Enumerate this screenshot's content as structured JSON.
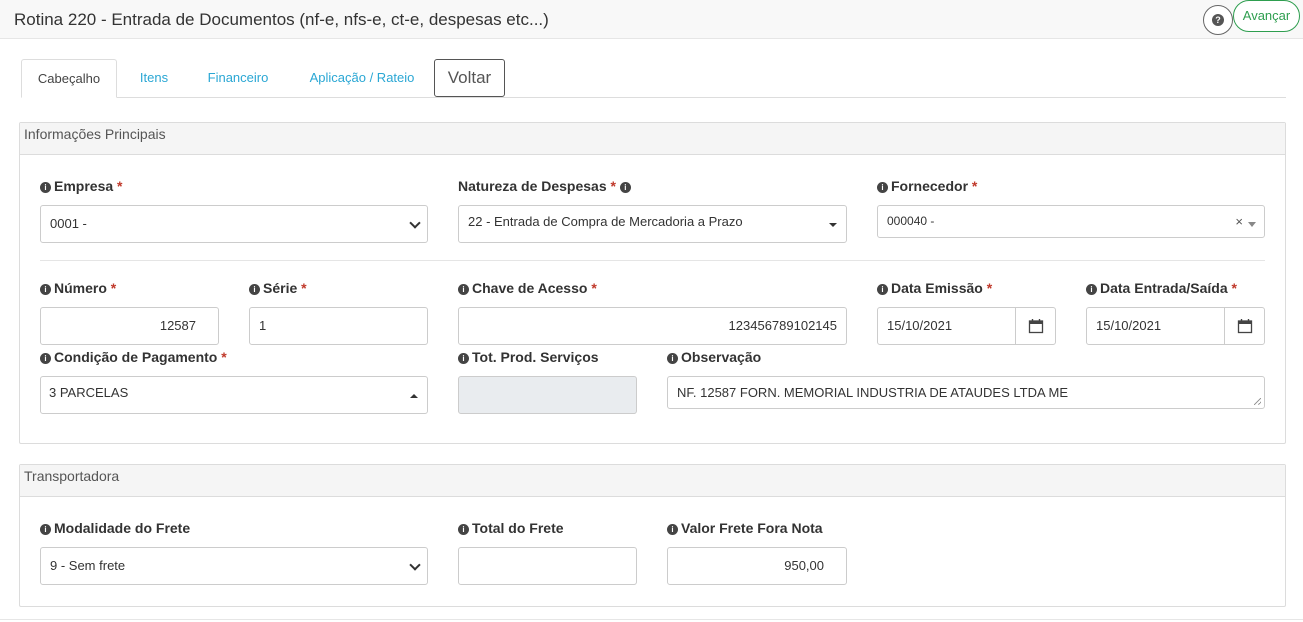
{
  "header": {
    "title": "Rotina 220 - Entrada de Documentos (nf-e, nfs-e, ct-e, despesas etc...)",
    "help_glyph": "?",
    "advance_label": "Avançar"
  },
  "tabs": [
    {
      "label": "Cabeçalho",
      "active": true
    },
    {
      "label": "Itens",
      "active": false
    },
    {
      "label": "Financeiro",
      "active": false
    },
    {
      "label": "Aplicação / Rateio",
      "active": false
    }
  ],
  "back_label": "Voltar",
  "main_info": {
    "title": "Informações Principais",
    "empresa": {
      "label": "Empresa",
      "required": "*",
      "value": "0001 -"
    },
    "natureza": {
      "label": "Natureza de Despesas",
      "required": "*",
      "value": "22 - Entrada de Compra de Mercadoria a Prazo"
    },
    "fornecedor": {
      "label": "Fornecedor",
      "required": "*",
      "value": "000040 -",
      "clear": "×"
    },
    "numero": {
      "label": "Número",
      "required": "*",
      "value": "12587"
    },
    "serie": {
      "label": "Série",
      "required": "*",
      "value": "1"
    },
    "chave": {
      "label": "Chave de Acesso",
      "required": "*",
      "value": "123456789102145"
    },
    "data_emissao": {
      "label": "Data Emissão",
      "required": "*",
      "value": "15/10/2021"
    },
    "data_entrada": {
      "label": "Data Entrada/Saída",
      "required": "*",
      "value": "15/10/2021"
    },
    "condicao": {
      "label": "Condição de Pagamento",
      "required": "*",
      "value": "3 PARCELAS"
    },
    "tot_prod": {
      "label": "Tot. Prod. Serviços",
      "value": ""
    },
    "observacao": {
      "label": "Observação",
      "value": "NF. 12587 FORN. MEMORIAL INDUSTRIA DE ATAUDES LTDA ME"
    }
  },
  "transport": {
    "title": "Transportadora",
    "modalidade": {
      "label": "Modalidade do Frete",
      "value": "9 - Sem frete"
    },
    "total_frete": {
      "label": "Total do Frete",
      "value": ""
    },
    "valor_frete": {
      "label": "Valor Frete Fora Nota",
      "value": "950,00"
    }
  },
  "icons": {
    "info": "info-circle-icon",
    "calendar": "calendar-icon",
    "help": "question-circle-icon"
  },
  "colors": {
    "accent_tab": "#2aa7d4",
    "advance_green": "#2e9e4f",
    "required_red": "#c0392b"
  }
}
